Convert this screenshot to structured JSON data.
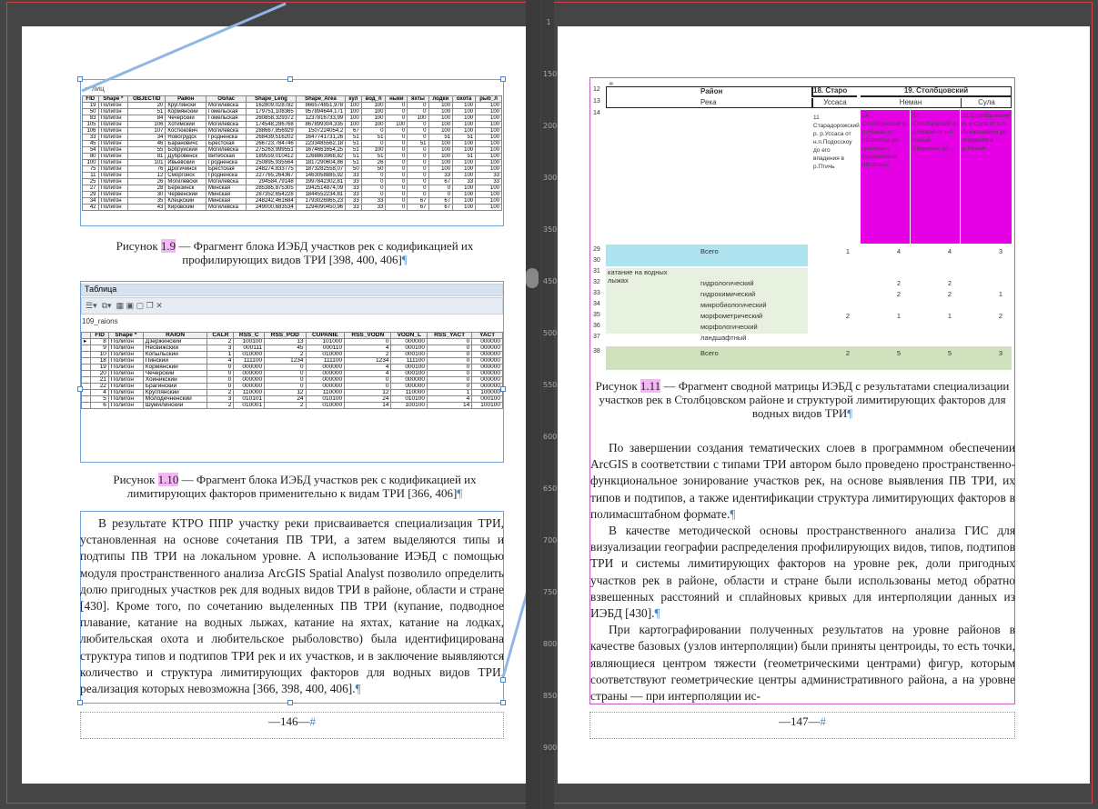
{
  "left_page": {
    "table1": {
      "headers": [
        "FID",
        "Shape *",
        "OBJECTID",
        "Район",
        "Облас",
        "Shape_Leng",
        "Shape_Area",
        "кул",
        "вод_п",
        "ныки",
        "яхты",
        "лодки",
        "охота",
        "рыб_л"
      ],
      "rows": [
        [
          "19",
          "Полигон",
          "20",
          "Круглянски",
          "Могилевска",
          "162809,028782",
          "866574851,978",
          "100",
          "100",
          "0",
          "0",
          "100",
          "100",
          "100"
        ],
        [
          "50",
          "Полигон",
          "51",
          "Кормянский",
          "Гомельская",
          "179751,108365",
          "957894644,171",
          "100",
          "100",
          "0",
          "0",
          "100",
          "100",
          "100"
        ],
        [
          "83",
          "Полигон",
          "84",
          "Чечерский",
          "Гомельская",
          "260858,329372",
          "1237816733,99",
          "100",
          "100",
          "0",
          "100",
          "100",
          "100",
          "100"
        ],
        [
          "105",
          "Полигон",
          "106",
          "Хотимский",
          "Могилевска",
          "174548,286768",
          "867899304,335",
          "100",
          "100",
          "100",
          "0",
          "100",
          "100",
          "100"
        ],
        [
          "106",
          "Полигон",
          "107",
          "Костюкович",
          "Могилевска",
          "288667,856929",
          "1507224054,2",
          "67",
          "0",
          "0",
          "0",
          "100",
          "100",
          "100"
        ],
        [
          "33",
          "Полигон",
          "34",
          "Новогрудск",
          "Гродненска",
          "268439,516202",
          "1647741731,26",
          "51",
          "51",
          "0",
          "0",
          "51",
          "51",
          "100"
        ],
        [
          "45",
          "Полигон",
          "46",
          "Барановичс",
          "Брестская",
          "266723,784746",
          "2233485562,18",
          "51",
          "0",
          "0",
          "51",
          "100",
          "100",
          "100"
        ],
        [
          "54",
          "Полигон",
          "55",
          "Бобруйский",
          "Могилевска",
          "275263,999551",
          "1674661654,25",
          "51",
          "100",
          "0",
          "0",
          "100",
          "100",
          "100"
        ],
        [
          "80",
          "Полигон",
          "81",
          "Дубровенск",
          "Витебская",
          "189559,010412",
          "1268863968,82",
          "51",
          "51",
          "0",
          "0",
          "100",
          "51",
          "100"
        ],
        [
          "100",
          "Полигон",
          "101",
          "Ивьевский",
          "Гродненска",
          "250895,935564",
          "1817290604,86",
          "51",
          "26",
          "0",
          "0",
          "100",
          "100",
          "100"
        ],
        [
          "75",
          "Полигон",
          "76",
          "Дрогичинск",
          "Брестская",
          "248274,833775",
          "1873282558,07",
          "50",
          "50",
          "0",
          "0",
          "100",
          "100",
          "100"
        ],
        [
          "11",
          "Полигон",
          "12",
          "Сморгонск",
          "Гродненска",
          "227765,264367",
          "1463058885,92",
          "33",
          "0",
          "0",
          "0",
          "33",
          "100",
          "33"
        ],
        [
          "25",
          "Полигон",
          "26",
          "Могилевски",
          "Могилевска",
          "294584,79148",
          "1997842302,81",
          "33",
          "0",
          "0",
          "0",
          "67",
          "33",
          "33"
        ],
        [
          "27",
          "Полигон",
          "28",
          "Березинск",
          "Минская",
          "285385,875305",
          "1942514874,09",
          "33",
          "0",
          "0",
          "0",
          "0",
          "100",
          "100"
        ],
        [
          "29",
          "Полигон",
          "30",
          "Червенский",
          "Минская",
          "287352,654228",
          "1844552234,81",
          "33",
          "0",
          "0",
          "0",
          "0",
          "100",
          "100"
        ],
        [
          "34",
          "Полигон",
          "35",
          "Клецкский",
          "Минская",
          "248242,461684",
          "1793026965,23",
          "33",
          "33",
          "0",
          "67",
          "67",
          "100",
          "100"
        ],
        [
          "42",
          "Полигон",
          "43",
          "Кировский",
          "Могилевска",
          "249000,683534",
          "1294090450,96",
          "33",
          "33",
          "0",
          "67",
          "67",
          "100",
          "100"
        ]
      ]
    },
    "caption1": {
      "prefix": "Рисунок ",
      "num": "1.9",
      "text": " — Фрагмент блока ИЭБД участков рек с кодификацией их профилирующих видов ТРИ [398, 400, 406]"
    },
    "table2": {
      "panel_title": "Таблица",
      "layer_name": "109_raions",
      "headers": [
        "",
        "FID",
        "Shape *",
        "RAION",
        "CALR",
        "RSS_C",
        "RSS_POD",
        "CUPANIE",
        "RSS_VODN",
        "VODN_L",
        "RSS_YACT",
        "YACT"
      ],
      "rows": [
        [
          "▸",
          "8",
          "Полигон",
          "Дзержинский",
          "2",
          "100100",
          "13",
          "101000",
          "0",
          "000000",
          "0",
          "000000"
        ],
        [
          "",
          "9",
          "Полигон",
          "Несвижский",
          "3",
          "000111",
          "45",
          "000110",
          "4",
          "000100",
          "0",
          "000000"
        ],
        [
          "",
          "10",
          "Полигон",
          "Копыльский",
          "1",
          "010000",
          "2",
          "010000",
          "2",
          "000100",
          "0",
          "000000"
        ],
        [
          "",
          "18",
          "Полигон",
          "Пинский",
          "4",
          "111100",
          "1234",
          "111100",
          "1234",
          "111100",
          "0",
          "000000"
        ],
        [
          "",
          "19",
          "Полигон",
          "Кормянский",
          "0",
          "000000",
          "0",
          "000000",
          "4",
          "000100",
          "0",
          "000000"
        ],
        [
          "",
          "20",
          "Полигон",
          "Чечерский",
          "0",
          "000000",
          "0",
          "000000",
          "4",
          "000100",
          "0",
          "000000"
        ],
        [
          "",
          "21",
          "Полигон",
          "Хойникский",
          "0",
          "000000",
          "0",
          "000000",
          "0",
          "000000",
          "0",
          "000000"
        ],
        [
          "",
          "22",
          "Полигон",
          "Брагинский",
          "0",
          "000000",
          "0",
          "000000",
          "0",
          "000000",
          "0",
          "000000"
        ],
        [
          "",
          "4",
          "Полигон",
          "Круглянский",
          "2",
          "110000",
          "12",
          "110000",
          "12",
          "110000",
          "1",
          "100000"
        ],
        [
          "",
          "5",
          "Полигон",
          "Молодечненский",
          "3",
          "010101",
          "24",
          "010100",
          "24",
          "010100",
          "4",
          "000100"
        ],
        [
          "",
          "6",
          "Полигон",
          "Шумилинский",
          "2",
          "010001",
          "2",
          "010000",
          "14",
          "100100",
          "14",
          "100100"
        ]
      ]
    },
    "caption2": {
      "prefix": "Рисунок ",
      "num": "1.10",
      "text": " — Фрагмент блока ИЭБД участков рек с кодификацией их лимитирующих факторов применительно к видам ТРИ [366, 406]"
    },
    "body": "В результате КТРО ППР участку реки присваивается специализация ТРИ, установленная на основе сочетания ПВ ТРИ, а затем выделяются типы и подтипы ПВ ТРИ на локальном уровне. А использование ИЭБД с помощью модуля пространственного анализа ArcGIS Spatial Analyst позволило определить долю пригодных участков рек для водных видов ТРИ в районе, области и стране [430]. Кроме того, по сочетанию выделенных ПВ ТРИ (купание, подводное плавание, катание на водных лыжах, катание на яхтах, катание на лодках, любительская охота и любительское рыболовство) была идентифицирована структура типов и подтипов ТРИ рек и их участков, и в заключение выявляются количество и структура лимитирующих факторов для водных видов ТРИ, реализация которых невозможна [366, 398, 400, 406].",
    "page_number": "146"
  },
  "right_page": {
    "matrix": {
      "rows": [
        "12",
        "13",
        "14",
        "29",
        "30",
        "31",
        "32",
        "33",
        "34",
        "35",
        "36",
        "37",
        "38"
      ],
      "col_region": "Район",
      "col_staro": "18. Старо",
      "col_stolb": "19. Столбцовский",
      "sub_reka": "Река",
      "sub_usasa": "Уссаса",
      "sub_neman": "Неман",
      "sub_sula": "Сула",
      "cell_text": "11 Старадорожский р. р.Уссаса от н.п.Подосскоу до его впадения в р.Птичь",
      "m1": "24 Столбцовский р. р.Неман от г.Столбцы до границы с Гродненской областью",
      "m2": "30 Столбцовский р. р.Неман от н.п. Новый Свержень до...",
      "m3": "31 Столбцовский р. р.Сула от н.п. Алексеевичи до впадения в р.Неман",
      "vsego": "Всего",
      "t29": [
        "1",
        "4",
        "4",
        "3"
      ],
      "label_a": "катание на водных лыжах",
      "factors": [
        "гидрологический",
        "гидрохимический",
        "микробиологический",
        "морфометрический",
        "морфологический",
        "ландшафтный"
      ],
      "v31": [
        "",
        "2",
        "2",
        ""
      ],
      "v32": [
        "",
        "2",
        "2",
        "1"
      ],
      "v34": [
        "2",
        "1",
        "1",
        "2"
      ],
      "t37": [
        "2",
        "5",
        "5",
        "3"
      ]
    },
    "caption3": {
      "prefix": "Рисунок ",
      "num": "1.11",
      "text": " — Фрагмент сводной матрицы ИЭБД с результатами специализации участков рек в Столбцовском районе и структурой лимитирующих факторов для водных видов ТРИ"
    },
    "body1": "По завершении создания тематических слоев в программном обеспечении ArcGIS в соответствии с типами ТРИ автором было проведено пространственно-функциональное зонирование участков рек, на основе выявления ПВ ТРИ, их типов и подтипов, а также идентификации структура лимитирующих факторов в полимасштабном формате.",
    "body2": "В качестве методической основы пространственного анализа ГИС для визуализации географии распределения профилирующих видов, типов, подтипов ТРИ и системы лимитирующих факторов на уровне рек, доли пригодных участков рек в районе, области и стране были использованы метод обратно взвешенных расстояний и сплайновых кривых для интерполяции данных из ИЭБД [430].",
    "body3": "При картографировании полученных результатов на уровне районов в качестве базовых (узлов интерполяции) были приняты центроиды, то есть точки, являющиеся центром тяжести (геометрическими центрами) фигур, которым соответствуют геометрические центры административного района, а на уровне страны — при интерполяции ис-",
    "page_number": "147"
  },
  "ruler_numbers": [
    "1",
    "150",
    "200",
    "300",
    "350",
    "450",
    "500",
    "550",
    "600",
    "650",
    "700",
    "750",
    "800",
    "850",
    "900"
  ],
  "colors": {
    "frame": "#6fa3d8",
    "magenta": "#e600e6",
    "cyan": "#aee3ef",
    "green": "#cfe2bd",
    "highlight": "#f3b7f3"
  }
}
